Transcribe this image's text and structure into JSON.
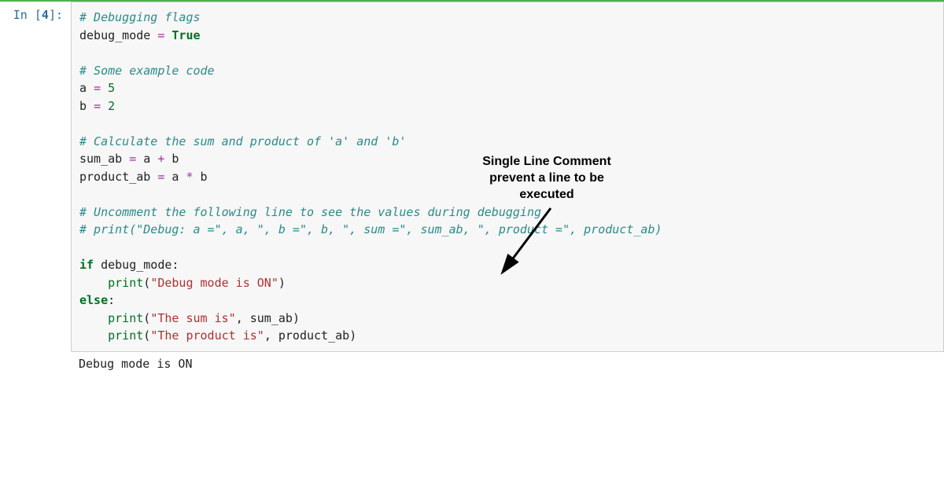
{
  "prompt": {
    "label": "In",
    "number": "4"
  },
  "code": {
    "l1_comment": "# Debugging flags",
    "l2_var": "debug_mode",
    "l2_eq": "=",
    "l2_val": "True",
    "l4_comment": "# Some example code",
    "l5_var": "a",
    "l5_eq": "=",
    "l5_val": "5",
    "l6_var": "b",
    "l6_eq": "=",
    "l6_val": "2",
    "l8_comment": "# Calculate the sum and product of 'a' and 'b'",
    "l9_var": "sum_ab",
    "l9_eq": "=",
    "l9_rhs_a": "a",
    "l9_rhs_op": "+",
    "l9_rhs_b": "b",
    "l10_var": "product_ab",
    "l10_eq": "=",
    "l10_rhs_a": "a",
    "l10_rhs_op": "*",
    "l10_rhs_b": "b",
    "l12_comment": "# Uncomment the following line to see the values during debugging",
    "l13_comment": "# print(\"Debug: a =\", a, \", b =\", b, \", sum =\", sum_ab, \", product =\", product_ab)",
    "l15_if": "if",
    "l15_cond": "debug_mode",
    "l15_colon": ":",
    "l16_indent": "    ",
    "l16_fn": "print",
    "l16_open": "(",
    "l16_str": "\"Debug mode is ON\"",
    "l16_close": ")",
    "l17_else": "else",
    "l17_colon": ":",
    "l18_indent": "    ",
    "l18_fn": "print",
    "l18_open": "(",
    "l18_str": "\"The sum is\"",
    "l18_comma": ",",
    "l18_arg": "sum_ab",
    "l18_close": ")",
    "l19_indent": "    ",
    "l19_fn": "print",
    "l19_open": "(",
    "l19_str": "\"The product is\"",
    "l19_comma": ",",
    "l19_arg": "product_ab",
    "l19_close": ")"
  },
  "output": "Debug mode is ON",
  "annotation": {
    "line1": "Single Line Comment",
    "line2": "prevent a line to be",
    "line3": "executed"
  }
}
